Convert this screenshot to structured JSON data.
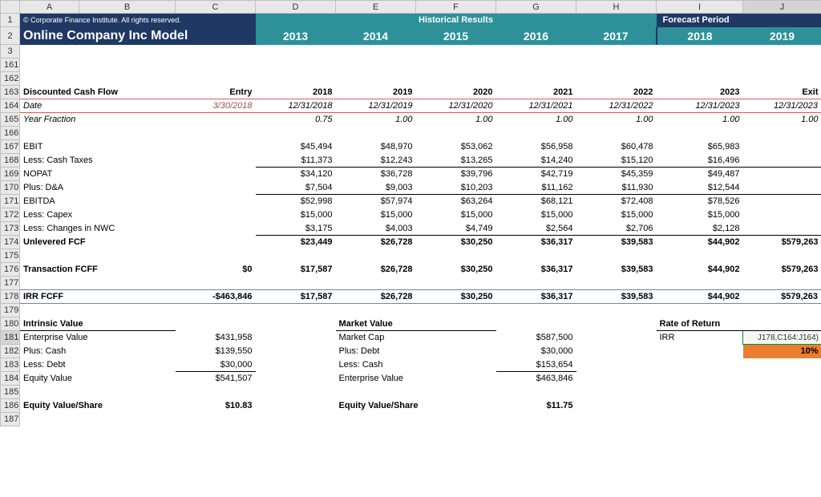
{
  "cols": [
    "A",
    "B",
    "C",
    "D",
    "E",
    "F",
    "G",
    "H",
    "I",
    "J"
  ],
  "header": {
    "copyright": "© Corporate Finance Institute. All rights reserved.",
    "hist": "Historical Results",
    "forecast": "Forecast Period",
    "title": "Online Company Inc Model",
    "years": [
      "2013",
      "2014",
      "2015",
      "2016",
      "2017",
      "2018",
      "2019"
    ]
  },
  "dcf": {
    "label": "Discounted Cash Flow",
    "entry": "Entry",
    "periods": [
      "2018",
      "2019",
      "2020",
      "2021",
      "2022",
      "2023",
      "Exit"
    ],
    "date_label": "Date",
    "date_entry": "3/30/2018",
    "dates": [
      "12/31/2018",
      "12/31/2019",
      "12/31/2020",
      "12/31/2021",
      "12/31/2022",
      "12/31/2023",
      "12/31/2023"
    ],
    "yf_label": "Year Fraction",
    "yf": [
      "0.75",
      "1.00",
      "1.00",
      "1.00",
      "1.00",
      "1.00",
      "1.00"
    ],
    "rows": [
      {
        "label": "EBIT",
        "vals": [
          "$45,494",
          "$48,970",
          "$53,062",
          "$56,958",
          "$60,478",
          "$65,983",
          ""
        ]
      },
      {
        "label": "Less: Cash Taxes",
        "vals": [
          "$11,373",
          "$12,243",
          "$13,265",
          "$14,240",
          "$15,120",
          "$16,496",
          ""
        ],
        "bb": true
      },
      {
        "label": "NOPAT",
        "vals": [
          "$34,120",
          "$36,728",
          "$39,796",
          "$42,719",
          "$45,359",
          "$49,487",
          ""
        ]
      },
      {
        "label": "Plus: D&A",
        "vals": [
          "$7,504",
          "$9,003",
          "$10,203",
          "$11,162",
          "$11,930",
          "$12,544",
          ""
        ],
        "bb": true
      },
      {
        "label": "EBITDA",
        "vals": [
          "$52,998",
          "$57,974",
          "$63,264",
          "$68,121",
          "$72,408",
          "$78,526",
          ""
        ]
      },
      {
        "label": "Less: Capex",
        "vals": [
          "$15,000",
          "$15,000",
          "$15,000",
          "$15,000",
          "$15,000",
          "$15,000",
          ""
        ]
      },
      {
        "label": "Less: Changes in NWC",
        "vals": [
          "$3,175",
          "$4,003",
          "$4,749",
          "$2,564",
          "$2,706",
          "$2,128",
          ""
        ],
        "bb": true
      },
      {
        "label": "Unlevered FCF",
        "bold": true,
        "vals": [
          "$23,449",
          "$26,728",
          "$30,250",
          "$36,317",
          "$39,583",
          "$44,902",
          "$579,263"
        ]
      }
    ],
    "tfcff": {
      "label": "Transaction FCFF",
      "entry": "$0",
      "vals": [
        "$17,587",
        "$26,728",
        "$30,250",
        "$36,317",
        "$39,583",
        "$44,902",
        "$579,263"
      ]
    },
    "irrfcff": {
      "label": "IRR FCFF",
      "entry": "-$463,846",
      "vals": [
        "$17,587",
        "$26,728",
        "$30,250",
        "$36,317",
        "$39,583",
        "$44,902",
        "$579,263"
      ]
    }
  },
  "bottom": {
    "iv": {
      "title": "Intrinsic Value",
      "rows": [
        {
          "l": "Enterprise Value",
          "v": "$431,958"
        },
        {
          "l": "Plus: Cash",
          "v": "$139,550"
        },
        {
          "l": "Less: Debt",
          "v": "$30,000",
          "bb": true
        },
        {
          "l": "Equity Value",
          "v": "$541,507"
        }
      ],
      "evs_l": "Equity Value/Share",
      "evs_v": "$10.83"
    },
    "mv": {
      "title": "Market Value",
      "rows": [
        {
          "l": "Market Cap",
          "v": "$587,500"
        },
        {
          "l": "Plus: Debt",
          "v": "$30,000"
        },
        {
          "l": "Less: Cash",
          "v": "$153,654",
          "bb": true
        },
        {
          "l": "Enterprise Value",
          "v": "$463,846"
        }
      ],
      "evs_l": "Equity Value/Share",
      "evs_v": "$11.75"
    },
    "ror": {
      "title": "Rate of Return",
      "irr_l": "IRR",
      "formula": "J178,C164:J164)",
      "pct": "10%"
    }
  },
  "rownums": [
    "1",
    "2",
    "3",
    "161",
    "162",
    "163",
    "164",
    "165",
    "166",
    "167",
    "168",
    "169",
    "170",
    "171",
    "172",
    "173",
    "174",
    "175",
    "176",
    "177",
    "178",
    "179",
    "180",
    "181",
    "182",
    "183",
    "184",
    "185",
    "186",
    "187"
  ]
}
